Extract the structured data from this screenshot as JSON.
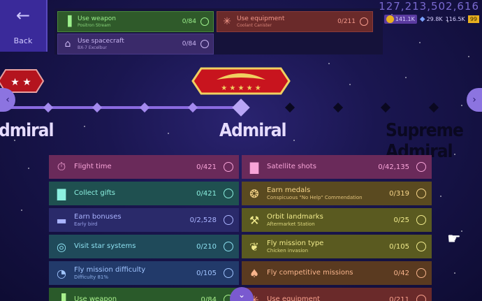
{
  "nav": {
    "back_label": "Back"
  },
  "top_goals": [
    {
      "title": "Use weapon",
      "subtitle": "Positron Stream",
      "count": "0/84",
      "color": "green",
      "icon": "gun-icon"
    },
    {
      "title": "Use equipment",
      "subtitle": "Coolant Canister",
      "count": "0/211",
      "color": "red",
      "icon": "snowflake-icon"
    },
    {
      "title": "Use spacecraft",
      "subtitle": "BX-7 Excelbur",
      "count": "0/84",
      "color": "purple",
      "icon": "spacecraft-icon"
    }
  ],
  "stats": {
    "score": "127,213,502,616",
    "coins": "141.1K",
    "resource_a": "29.8K",
    "resource_b": "116.5K",
    "resource_c": "99"
  },
  "ranks": {
    "prev": "dmiral",
    "current": "Admiral",
    "next": "Supreme Admiral"
  },
  "challenges_left": [
    {
      "title": "Flight time",
      "subtitle": "",
      "count": "0/421",
      "color": "pink",
      "icon": "stopwatch-icon"
    },
    {
      "title": "Collect gifts",
      "subtitle": "",
      "count": "0/421",
      "color": "teal",
      "icon": "bars-icon"
    },
    {
      "title": "Earn bonuses",
      "subtitle": "Early bird",
      "count": "0/2,528",
      "color": "indigo",
      "icon": "bonus-icon"
    },
    {
      "title": "Visit star systems",
      "subtitle": "",
      "count": "0/210",
      "color": "cyan",
      "icon": "orbit-icon"
    },
    {
      "title": "Fly mission difficulty",
      "subtitle": "Difficulty 81%",
      "count": "0/105",
      "color": "blue",
      "icon": "gauge-icon"
    },
    {
      "title": "Use weapon",
      "subtitle": "",
      "count": "0/84",
      "color": "green",
      "icon": "gun-icon"
    }
  ],
  "challenges_right": [
    {
      "title": "Satellite shots",
      "subtitle": "",
      "count": "0/42,135",
      "color": "pink",
      "icon": "bars-icon"
    },
    {
      "title": "Earn medals",
      "subtitle": "Conspicuous \"No Help\" Commendation",
      "count": "0/319",
      "color": "gold",
      "icon": "medal-icon"
    },
    {
      "title": "Orbit landmarks",
      "subtitle": "Aftermarket Station",
      "count": "0/25",
      "color": "olive",
      "icon": "robot-arm-icon"
    },
    {
      "title": "Fly mission type",
      "subtitle": "Chicken invasion",
      "count": "0/105",
      "color": "olive",
      "icon": "chicken-icon"
    },
    {
      "title": "Fly competitive missions",
      "subtitle": "",
      "count": "0/42",
      "color": "orange",
      "icon": "trophy-icon"
    },
    {
      "title": "Use equipment",
      "subtitle": "",
      "count": "0/211",
      "color": "red",
      "icon": "snowflake-icon"
    }
  ]
}
